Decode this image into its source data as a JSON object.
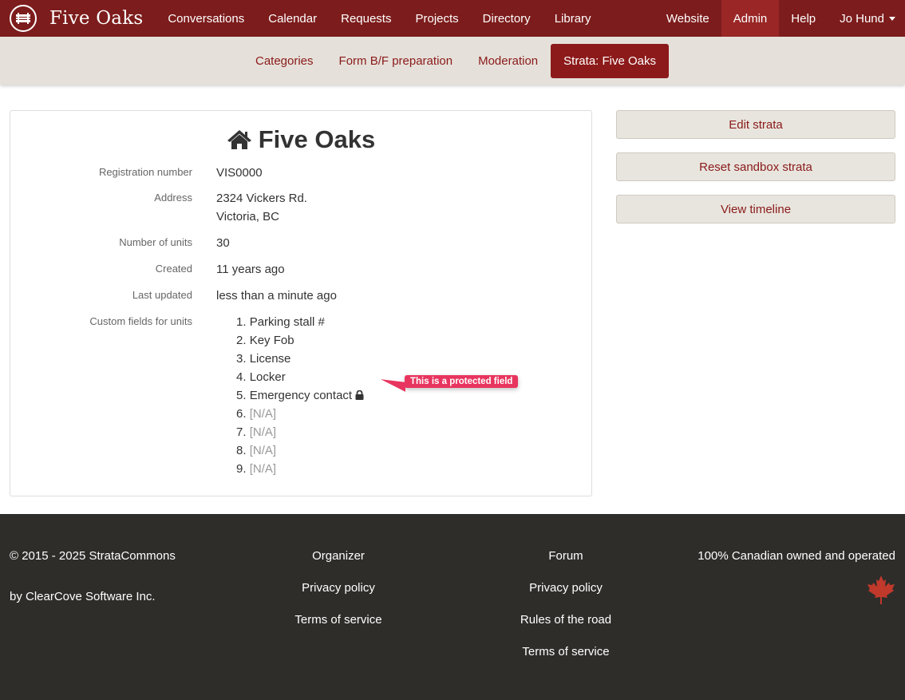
{
  "navbar": {
    "brand": "Five Oaks",
    "items": [
      "Conversations",
      "Calendar",
      "Requests",
      "Projects",
      "Directory",
      "Library"
    ],
    "right_items": [
      "Website",
      "Admin",
      "Help"
    ],
    "user": "Jo Hund",
    "active": "Admin"
  },
  "subnav": {
    "items": [
      "Categories",
      "Form B/F preparation",
      "Moderation",
      "Strata: Five Oaks"
    ],
    "active": "Strata: Five Oaks"
  },
  "strata": {
    "title": "Five Oaks",
    "labels": {
      "registration": "Registration number",
      "address": "Address",
      "units": "Number of units",
      "created": "Created",
      "updated": "Last updated",
      "custom_fields": "Custom fields for units"
    },
    "registration": "VIS0000",
    "address_line1": "2324 Vickers Rd.",
    "address_line2": "Victoria, BC",
    "units": "30",
    "created": "11 years ago",
    "updated": "less than a minute ago",
    "custom_fields": [
      {
        "num": "1.",
        "name": "Parking stall #"
      },
      {
        "num": "2.",
        "name": "Key Fob"
      },
      {
        "num": "3.",
        "name": "License"
      },
      {
        "num": "4.",
        "name": "Locker"
      },
      {
        "num": "5.",
        "name": "Emergency contact"
      },
      {
        "num": "6.",
        "name": "[N/A]"
      },
      {
        "num": "7.",
        "name": "[N/A]"
      },
      {
        "num": "8.",
        "name": "[N/A]"
      },
      {
        "num": "9.",
        "name": "[N/A]"
      }
    ],
    "tooltip": "This is a protected field"
  },
  "actions": {
    "edit": "Edit strata",
    "reset": "Reset sandbox strata",
    "timeline": "View timeline"
  },
  "footer": {
    "copyright": "© 2015 - 2025 StrataCommons",
    "company": "by ClearCove Software Inc.",
    "organizer": [
      "Organizer",
      "Privacy policy",
      "Terms of service"
    ],
    "forum": [
      "Forum",
      "Privacy policy",
      "Rules of the road",
      "Terms of service"
    ],
    "canadian": "100% Canadian owned and operated"
  },
  "colors": {
    "navbar": "#7d1c1c",
    "accent": "#8d1a1a",
    "tooltip": "#e8355f",
    "footer": "#2e2d2a"
  }
}
